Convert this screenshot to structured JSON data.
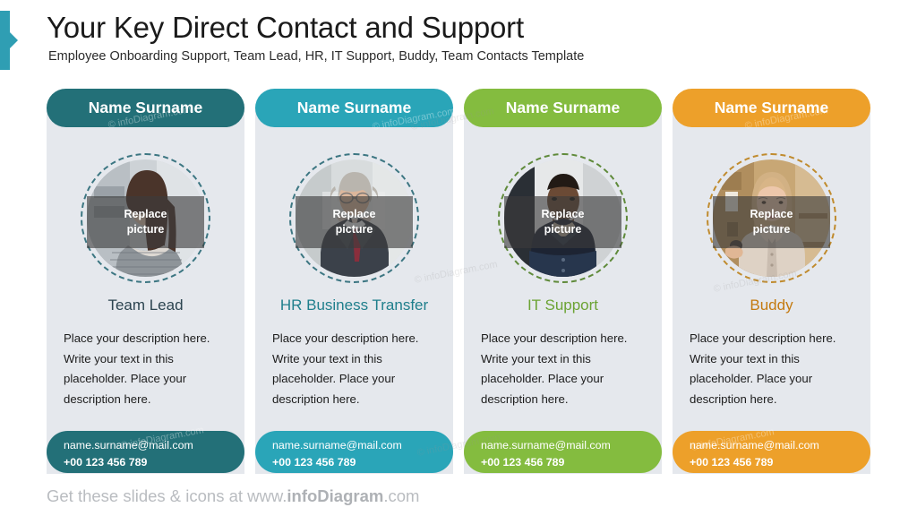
{
  "header": {
    "title": "Your Key Direct Contact and Support",
    "subtitle": "Employee Onboarding Support, Team Lead, HR, IT Support, Buddy, Team Contacts Template"
  },
  "footer": {
    "prefix": "Get these slides & icons at www.",
    "brand": "infoDiagram",
    "suffix": ".com"
  },
  "watermark": {
    "text": "© infoDiagram.com"
  },
  "photo_overlay": {
    "line1": "Replace",
    "line2": "picture"
  },
  "colors": {
    "accent_bar": "#2f9eb3",
    "card_body": "#e5e8ed",
    "card1": "#237078",
    "card2": "#2aa5b8",
    "card3": "#84bc3f",
    "card4": "#eda02a",
    "role1": "#2c4450",
    "role2": "#1f7f8c",
    "role3": "#6ba333",
    "role4": "#c47a10"
  },
  "cards": [
    {
      "header_label": "Name Surname",
      "role": "Team Lead",
      "description": "Place your description here. Write your text in this placeholder. Place your description here.",
      "email": "name.surname@mail.com",
      "phone": "+00 123 456 789",
      "photo_alt": "young-woman-with-long-dark-hair-photo"
    },
    {
      "header_label": "Name Surname",
      "role": "HR Business Transfer",
      "description": "Place your description here. Write your text in this placeholder. Place your description here.",
      "email": "name.surname@mail.com",
      "phone": "+00 123 456 789",
      "photo_alt": "older-man-with-grey-hair-suit-photo"
    },
    {
      "header_label": "Name Surname",
      "role": "IT Support",
      "description": "Place your description here. Write your text in this placeholder. Place your description here.",
      "email": "name.surname@mail.com",
      "phone": "+00 123 456 789",
      "photo_alt": "young-man-dark-jacket-photo"
    },
    {
      "header_label": "Name Surname",
      "role": "Buddy",
      "description": "Place your description here. Write your text in this placeholder. Place your description here.",
      "email": "name.surname@mail.com",
      "phone": "+00 123 456 789",
      "photo_alt": "blonde-woman-smiling-photo"
    }
  ]
}
